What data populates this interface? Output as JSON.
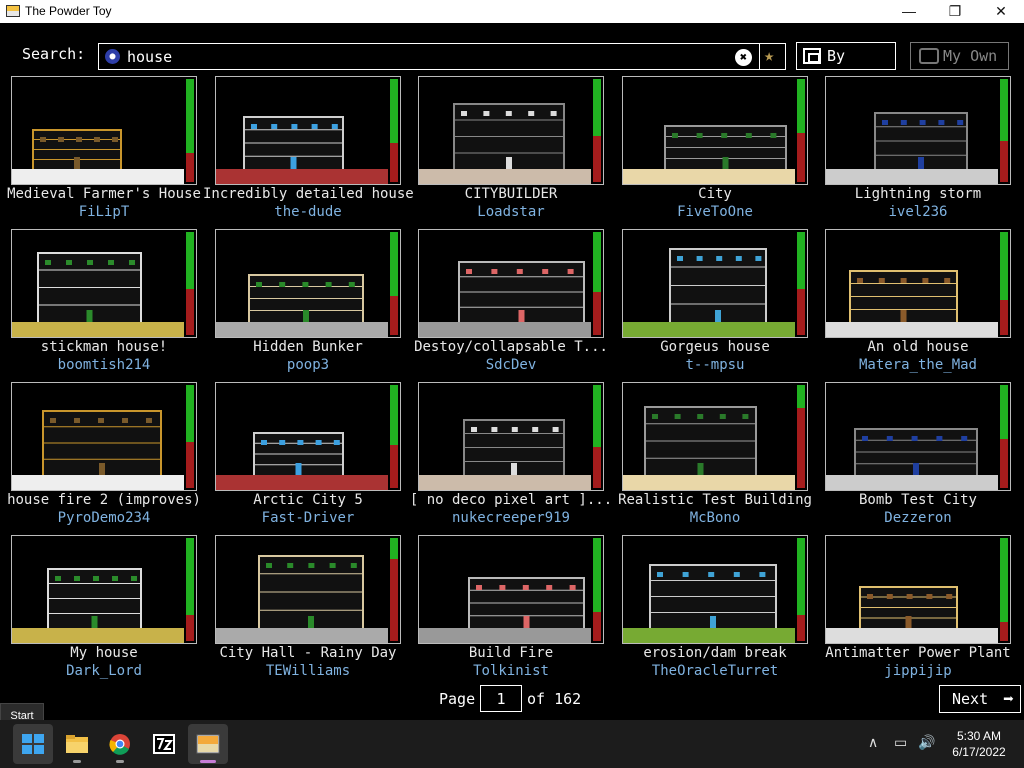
{
  "window": {
    "title": "The Powder Toy",
    "minimize": "—",
    "maximize": "❐",
    "close": "✕"
  },
  "search": {
    "label": "Search:",
    "query": "house",
    "clear_icon": "✖",
    "fav_icon": "★",
    "icon": "magnifier-icon"
  },
  "toolbar": {
    "sort_label": "By votes",
    "my_own_label": "My Own"
  },
  "colors": {
    "vote_up": "#21b221",
    "vote_down": "#a41c1c",
    "author": "#7fb2e0",
    "title": "#e8e8e8"
  },
  "saves": [
    {
      "title": "Medieval Farmer's House",
      "author": "FiLipT",
      "score": 0.72
    },
    {
      "title": "Incredibly detailed house",
      "author": "the-dude",
      "score": 0.62
    },
    {
      "title": "CITYBUILDER",
      "author": "Loadstar",
      "score": 0.55
    },
    {
      "title": "City",
      "author": "FiveToOne",
      "score": 0.52
    },
    {
      "title": "Lightning storm",
      "author": "ivel236",
      "score": 0.6
    },
    {
      "title": "stickman house!",
      "author": "boomtish214",
      "score": 0.55
    },
    {
      "title": "Hidden Bunker",
      "author": "poop3",
      "score": 0.62
    },
    {
      "title": "Destoy/collapsable T...",
      "author": "SdcDev",
      "score": 0.58
    },
    {
      "title": "Gorgeus house",
      "author": "t--mpsu",
      "score": 0.55
    },
    {
      "title": "An old house",
      "author": "Matera_the_Mad",
      "score": 0.66
    },
    {
      "title": "house fire 2 (improves)",
      "author": "PyroDemo234",
      "score": 0.55
    },
    {
      "title": "Arctic City 5",
      "author": "Fast-Driver",
      "score": 0.58
    },
    {
      "title": "[ no deco pixel art ]...",
      "author": "nukecreeper919",
      "score": 0.6
    },
    {
      "title": "Realistic Test Building",
      "author": "McBono",
      "score": 0.22
    },
    {
      "title": "Bomb Test City",
      "author": "Dezzeron",
      "score": 0.52
    },
    {
      "title": "My house",
      "author": "Dark_Lord",
      "score": 0.75
    },
    {
      "title": "City Hall - Rainy Day",
      "author": "TEWilliams",
      "score": 0.2
    },
    {
      "title": "Build Fire",
      "author": "Tolkinist",
      "score": 0.72
    },
    {
      "title": "erosion/dam break",
      "author": "TheOracleTurret",
      "score": 0.75
    },
    {
      "title": "Antimatter Power Plant",
      "author": "jippijip",
      "score": 0.82
    }
  ],
  "pagination": {
    "page_label": "Page",
    "current_page": "1",
    "of_label": "of 162",
    "next_label": "Next",
    "next_icon": "➡"
  },
  "tooltip": {
    "text": "Start"
  },
  "taskbar": {
    "apps": [
      "start-icon",
      "file-explorer-icon",
      "chrome-icon",
      "7zip-icon",
      "powder-toy-icon"
    ],
    "tray_chevron": "∧",
    "tray_network": "▭",
    "tray_volume": "🔊",
    "time": "5:30 AM",
    "date": "6/17/2022"
  }
}
